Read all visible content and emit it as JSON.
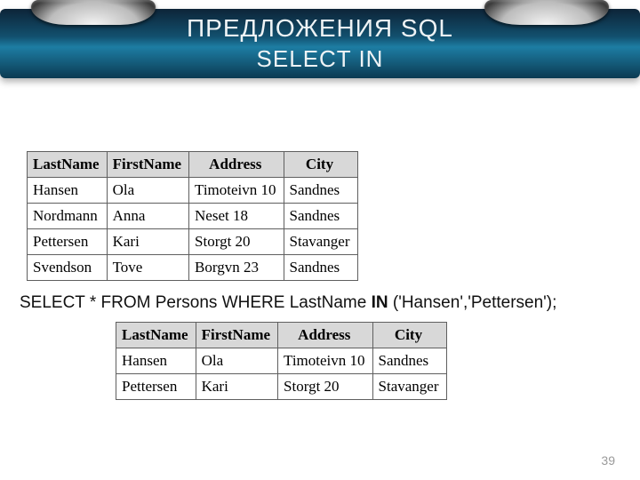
{
  "header": {
    "title_line1": "ПРЕДЛОЖЕНИЯ SQL",
    "title_line2": "SELECT IN"
  },
  "table1": {
    "headers": [
      "LastName",
      "FirstName",
      "Address",
      "City"
    ],
    "rows": [
      [
        "Hansen",
        "Ola",
        "Timoteivn 10",
        "Sandnes"
      ],
      [
        "Nordmann",
        "Anna",
        "Neset 18",
        "Sandnes"
      ],
      [
        "Pettersen",
        "Kari",
        "Storgt 20",
        "Stavanger"
      ],
      [
        "Svendson",
        "Tove",
        "Borgvn 23",
        "Sandnes"
      ]
    ]
  },
  "sql": {
    "prefix": "SELECT * FROM Persons WHERE LastName ",
    "keyword": "IN",
    "suffix": " ('Hansen','Pettersen');"
  },
  "table2": {
    "headers": [
      "LastName",
      "FirstName",
      "Address",
      "City"
    ],
    "rows": [
      [
        "Hansen",
        "Ola",
        "Timoteivn 10",
        "Sandnes"
      ],
      [
        "Pettersen",
        "Kari",
        "Storgt 20",
        "Stavanger"
      ]
    ]
  },
  "page_number": "39"
}
